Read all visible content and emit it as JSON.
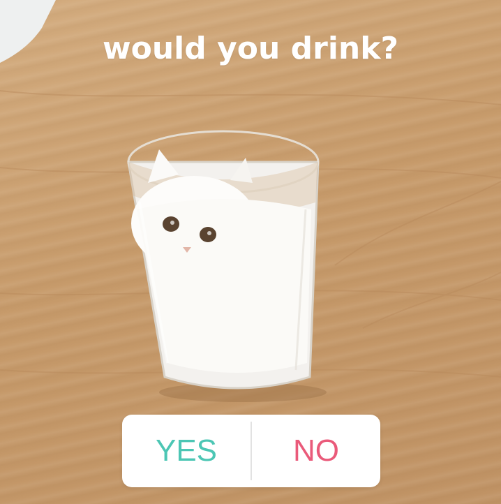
{
  "story": {
    "caption": "would you drink?",
    "photo_subject": "white-cat-in-clear-glass"
  },
  "poll": {
    "option_yes": "YES",
    "option_no": "NO",
    "yes_color": "#4cc6b4",
    "no_color": "#ea5a7a"
  }
}
